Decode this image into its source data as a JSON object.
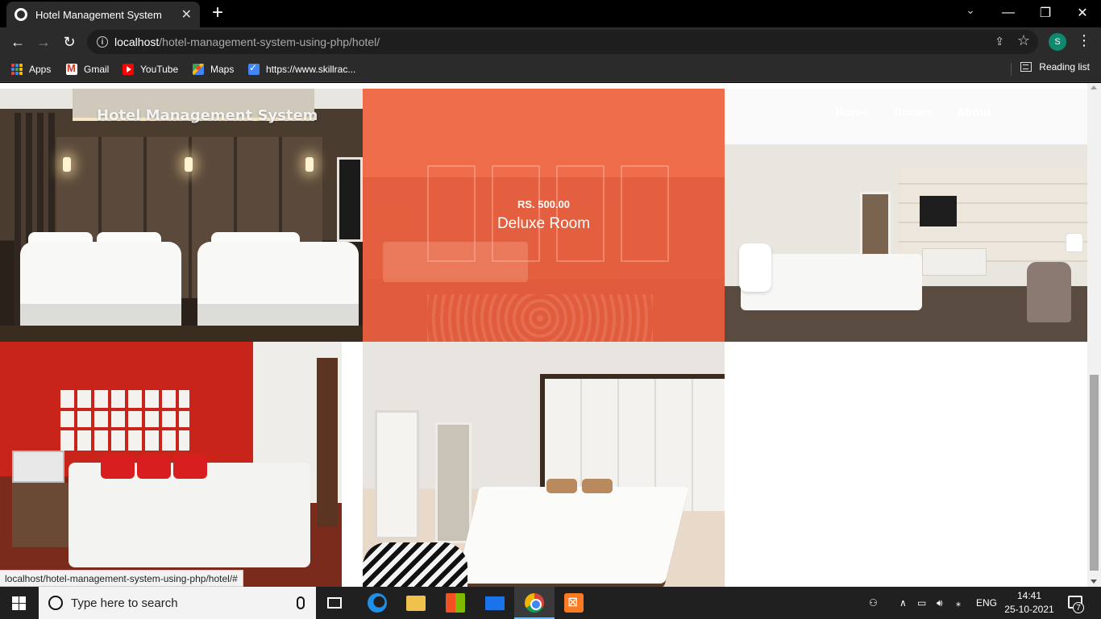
{
  "browser": {
    "tab_title": "Hotel Management System",
    "tab_close": "✕",
    "new_tab": "+",
    "address": {
      "host": "localhost",
      "path": "/hotel-management-system-using-php/hotel/"
    },
    "profile_initial": "S",
    "bookmarks": [
      {
        "label": "Apps",
        "icon": "apps-grid-icon"
      },
      {
        "label": "Gmail",
        "icon": "gmail-icon"
      },
      {
        "label": "YouTube",
        "icon": "youtube-icon"
      },
      {
        "label": "Maps",
        "icon": "maps-icon"
      },
      {
        "label": "https://www.skillrac...",
        "icon": "skillrack-icon"
      }
    ],
    "reading_list": "Reading list",
    "status_url": "localhost/hotel-management-system-using-php/hotel/#"
  },
  "site": {
    "title": "Hotel Management System",
    "nav": [
      "Home",
      "Rooms",
      "About"
    ]
  },
  "rooms": {
    "featured": {
      "price": "RS. 500.00",
      "name": "Deluxe Room"
    }
  },
  "taskbar": {
    "search_placeholder": "Type here to search",
    "language": "ENG",
    "time": "14:41",
    "date": "25-10-2021",
    "notification_count": "7",
    "colors": {
      "accent": "#76b9ed",
      "background": "#202020"
    }
  },
  "colors": {
    "overlay": "#f0603e",
    "profile": "#0d8a6d"
  }
}
